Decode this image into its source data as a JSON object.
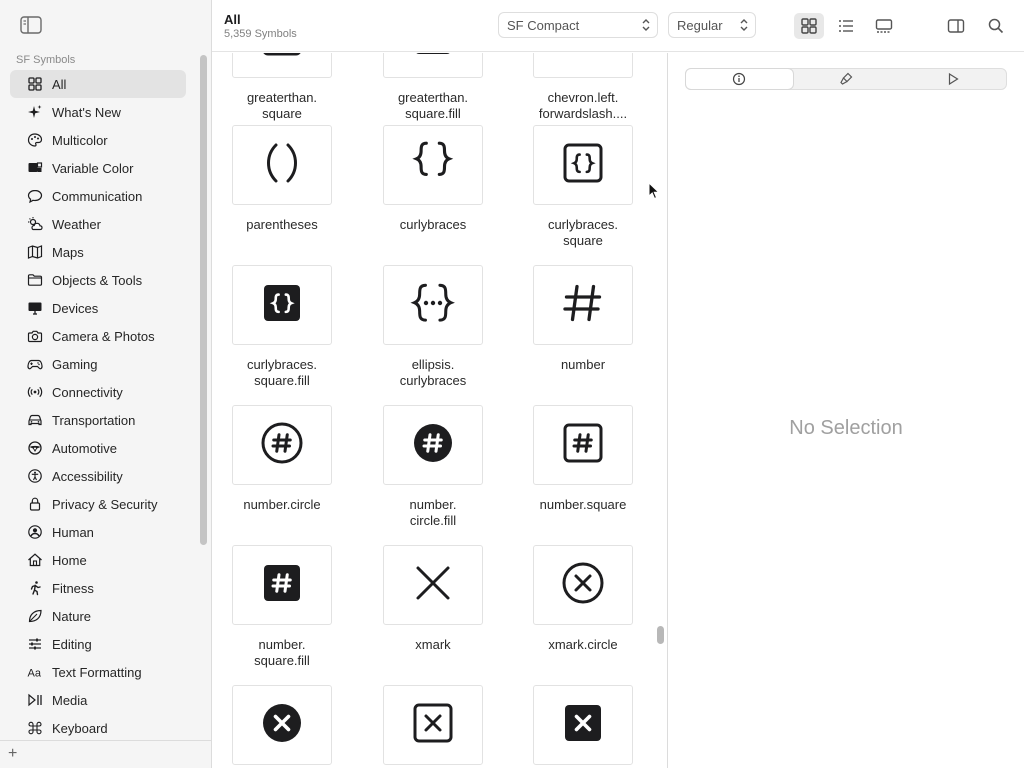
{
  "sidebar": {
    "section_title": "SF Symbols",
    "items": [
      {
        "label": "All",
        "icon": "grid-icon",
        "active": true
      },
      {
        "label": "What's New",
        "icon": "sparkles-icon"
      },
      {
        "label": "Multicolor",
        "icon": "palette-icon"
      },
      {
        "label": "Variable Color",
        "icon": "variable-color-icon"
      },
      {
        "label": "Communication",
        "icon": "message-icon"
      },
      {
        "label": "Weather",
        "icon": "cloud-sun-icon"
      },
      {
        "label": "Maps",
        "icon": "map-icon"
      },
      {
        "label": "Objects & Tools",
        "icon": "folder-icon"
      },
      {
        "label": "Devices",
        "icon": "desktop-icon"
      },
      {
        "label": "Camera & Photos",
        "icon": "camera-icon"
      },
      {
        "label": "Gaming",
        "icon": "gamecontroller-icon"
      },
      {
        "label": "Connectivity",
        "icon": "antenna-icon"
      },
      {
        "label": "Transportation",
        "icon": "car-icon"
      },
      {
        "label": "Automotive",
        "icon": "steering-wheel-icon"
      },
      {
        "label": "Accessibility",
        "icon": "accessibility-icon"
      },
      {
        "label": "Privacy & Security",
        "icon": "lock-icon"
      },
      {
        "label": "Human",
        "icon": "person-icon"
      },
      {
        "label": "Home",
        "icon": "house-icon"
      },
      {
        "label": "Fitness",
        "icon": "figure-run-icon"
      },
      {
        "label": "Nature",
        "icon": "leaf-icon"
      },
      {
        "label": "Editing",
        "icon": "sliders-icon"
      },
      {
        "label": "Text Formatting",
        "icon": "textformat-icon"
      },
      {
        "label": "Media",
        "icon": "playpause-icon"
      },
      {
        "label": "Keyboard",
        "icon": "command-icon"
      }
    ]
  },
  "toolbar": {
    "title": "All",
    "subtitle": "5,359 Symbols",
    "font_value": "SF Compact",
    "weight_value": "Regular"
  },
  "grid": {
    "items": [
      {
        "label": "greaterthan.\nsquare",
        "icon": "greaterthan-square-icon"
      },
      {
        "label": "greaterthan.\nsquare.fill",
        "icon": "greaterthan-square-fill-icon"
      },
      {
        "label": "chevron.left.\nforwardslash....",
        "icon": "chevron-left-forwardslash-icon"
      },
      {
        "label": "parentheses",
        "icon": "parentheses-icon"
      },
      {
        "label": "curlybraces",
        "icon": "curlybraces-icon"
      },
      {
        "label": "curlybraces.\nsquare",
        "icon": "curlybraces-square-icon"
      },
      {
        "label": "curlybraces.\nsquare.fill",
        "icon": "curlybraces-square-fill-icon"
      },
      {
        "label": "ellipsis.\ncurlybraces",
        "icon": "ellipsis-curlybraces-icon"
      },
      {
        "label": "number",
        "icon": "number-icon"
      },
      {
        "label": "number.circle",
        "icon": "number-circle-icon"
      },
      {
        "label": "number.\ncircle.fill",
        "icon": "number-circle-fill-icon"
      },
      {
        "label": "number.square",
        "icon": "number-square-icon"
      },
      {
        "label": "number.\nsquare.fill",
        "icon": "number-square-fill-icon"
      },
      {
        "label": "xmark",
        "icon": "xmark-icon"
      },
      {
        "label": "xmark.circle",
        "icon": "xmark-circle-icon"
      },
      {
        "label": "",
        "icon": "xmark-circle-fill-icon"
      },
      {
        "label": "",
        "icon": "xmark-square-icon"
      },
      {
        "label": "",
        "icon": "xmark-square-fill-icon"
      }
    ]
  },
  "inspector": {
    "empty_text": "No Selection"
  }
}
